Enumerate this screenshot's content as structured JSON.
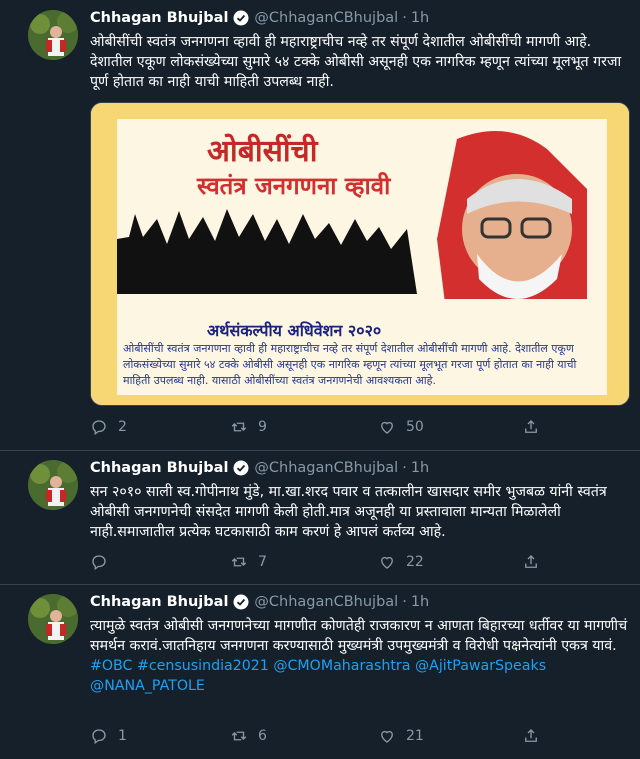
{
  "tweets": [
    {
      "name": "Chhagan Bhujbal",
      "handle": "@ChhaganCBhujbal",
      "separator": "·",
      "time": "1h",
      "text": "ओबीसींची स्वतंत्र जनगणना व्हावी ही महाराष्ट्राचीच नव्हे तर संपूर्ण देशातील ओबीसींची मागणी आहे. देशातील एकूण लोकसंख्येच्या सुमारे ५४ टक्के ओबीसी असूनही एक नागरिक म्हणून त्यांच्या मूलभूत गरजा पूर्ण होतात का नाही याची माहिती उपलब्ध नाही.",
      "image": {
        "title_line1": "ओबीसींची",
        "title_line2": "स्वतंत्र जनगणना व्हावी",
        "session": "अर्थसंकल्पीय अधिवेशन २०२०",
        "caption": "ओबीसींची स्वतंत्र जनगणना व्हावी ही महाराष्ट्राचीच नव्हे तर संपूर्ण देशातील ओबीसींची मागणी आहे. देशातील एकूण लोकसंख्येच्या सुमारे ५४ टक्के ओबीसी असूनही एक नागरिक म्हणून त्यांच्या मूलभूत गरजा पूर्ण होतात का नाही याची माहिती उपलब्ध नाही. यासाठी ओबीसींच्या स्वतंत्र जनगणनेची आवश्यकता आहे."
      },
      "replies": "2",
      "retweets": "9",
      "likes": "50"
    },
    {
      "name": "Chhagan Bhujbal",
      "handle": "@ChhaganCBhujbal",
      "separator": "·",
      "time": "1h",
      "text": "सन २०१० साली स्व.गोपीनाथ मुंडे, मा.खा.शरद पवार व तत्कालीन खासदार समीर भुजबळ यांनी स्वतंत्र ओबीसी जनगणनेची संसदेत मागणी केली होती.मात्र अजूनही या प्रस्तावाला मान्यता मिळालेली नाही.समाजातील प्रत्येक घटकासाठी काम करणं हे आपलं कर्तव्य आहे.",
      "replies": "",
      "retweets": "7",
      "likes": "22"
    },
    {
      "name": "Chhagan Bhujbal",
      "handle": "@ChhaganCBhujbal",
      "separator": "·",
      "time": "1h",
      "text": "त्यामुळे स्वतंत्र ओबीसी जनगणनेच्या मागणीत कोणतेही राजकारण न आणता बिहारच्या धर्तीवर या मागणीचं समर्थन करावं.जातनिहाय जनगणना करण्यासाठी मुख्यमंत्री उपमुख्यमंत्री व विरोधी पक्षनेत्यांनी एकत्र यावं.",
      "hashtags": "#OBC #censusindia2021 @CMOMaharashtra @AjitPawarSpeaks @NANA_PATOLE",
      "replies": "1",
      "retweets": "6",
      "likes": "21"
    }
  ],
  "colors": {
    "background": "#15202b",
    "muted": "#8899a6",
    "link": "#1da1f2",
    "verified": "#ffffff"
  }
}
